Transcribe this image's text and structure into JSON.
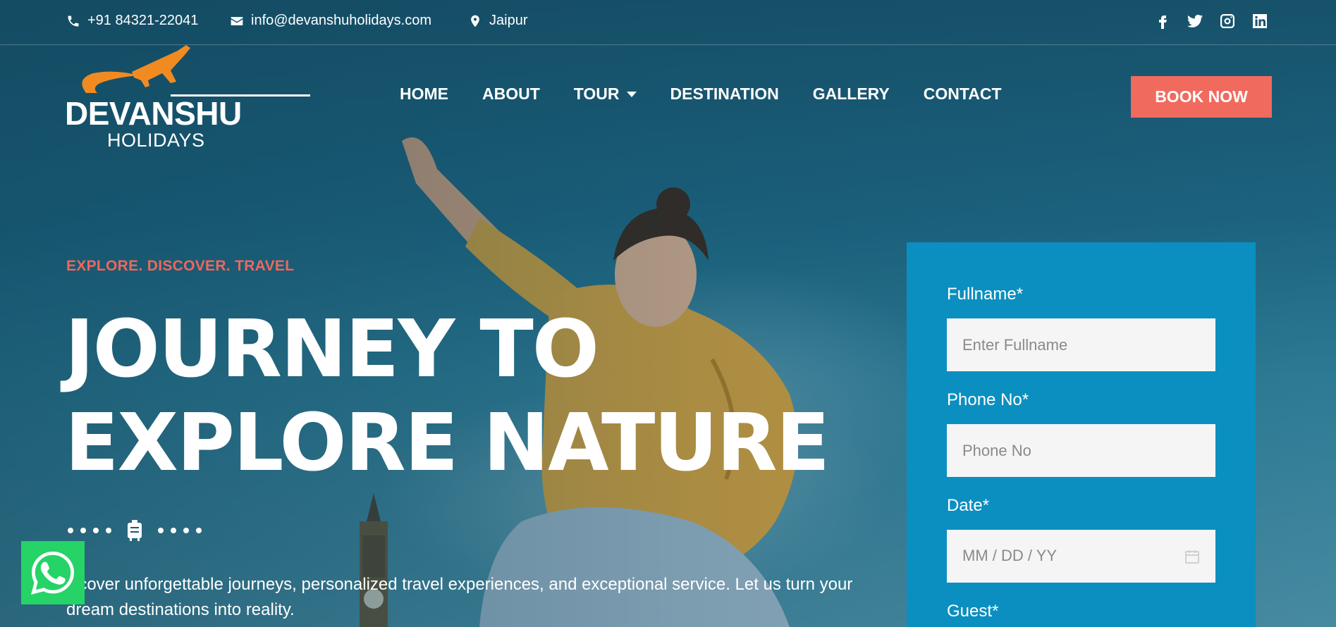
{
  "topbar": {
    "phone": "+91 84321-22041",
    "email": "info@devanshuholidays.com",
    "location": "Jaipur",
    "socials": [
      "facebook-icon",
      "twitter-icon",
      "instagram-icon",
      "linkedin-icon"
    ]
  },
  "logo": {
    "line1": "DEVANSHU",
    "line2": "HOLIDAYS"
  },
  "nav": {
    "items": [
      {
        "label": "HOME"
      },
      {
        "label": "ABOUT"
      },
      {
        "label": "TOUR",
        "has_dropdown": true
      },
      {
        "label": "DESTINATION"
      },
      {
        "label": "GALLERY"
      },
      {
        "label": "CONTACT"
      }
    ],
    "cta_label": "BOOK NOW"
  },
  "hero": {
    "eyebrow": "EXPLORE. DISCOVER. TRAVEL",
    "title_line1": "JOURNEY TO",
    "title_line2": "EXPLORE NATURE",
    "description": "iscover unforgettable journeys, personalized travel experiences, and exceptional service. Let us turn your dream destinations into reality."
  },
  "form": {
    "fullname_label": "Fullname*",
    "fullname_placeholder": "Enter Fullname",
    "phone_label": "Phone No*",
    "phone_placeholder": "Phone No",
    "date_label": "Date*",
    "date_placeholder": "MM / DD / YY",
    "guest_label": "Guest*"
  },
  "colors": {
    "accent": "#f16a5e",
    "form_bg": "#0b8fc0",
    "whatsapp": "#25d366",
    "logo_orange": "#f28a22"
  }
}
